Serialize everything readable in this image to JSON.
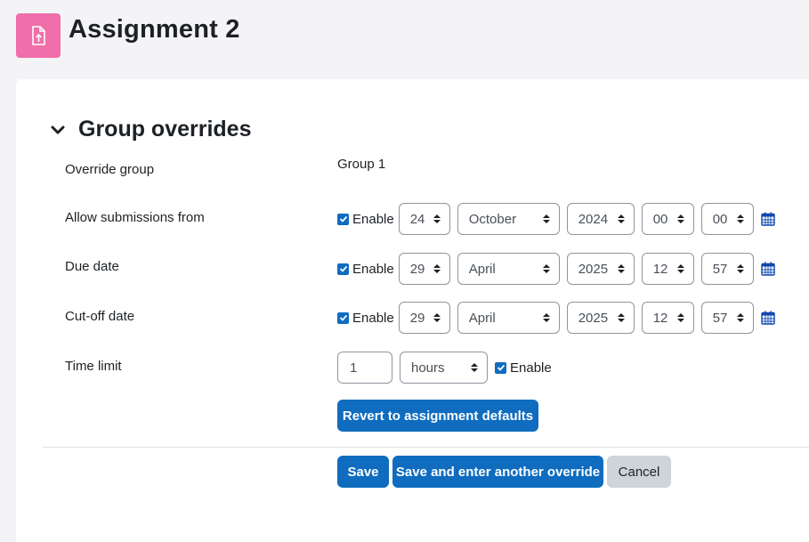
{
  "page": {
    "title": "Assignment 2",
    "icon": "assignment-upload-icon",
    "icon_color": "#f06eaa"
  },
  "section": {
    "title": "Group overrides"
  },
  "fields": {
    "override_group": {
      "label": "Override group",
      "value": "Group 1"
    },
    "allow_from": {
      "label": "Allow submissions from",
      "enable_label": "Enable",
      "day": "24",
      "month": "October",
      "year": "2024",
      "hour": "00",
      "minute": "00"
    },
    "due_date": {
      "label": "Due date",
      "enable_label": "Enable",
      "day": "29",
      "month": "April",
      "year": "2025",
      "hour": "12",
      "minute": "57"
    },
    "cutoff_date": {
      "label": "Cut-off date",
      "enable_label": "Enable",
      "day": "29",
      "month": "April",
      "year": "2025",
      "hour": "12",
      "minute": "57"
    },
    "time_limit": {
      "label": "Time limit",
      "value": "1",
      "unit": "hours",
      "enable_label": "Enable"
    }
  },
  "buttons": {
    "revert": "Revert to assignment defaults",
    "save": "Save",
    "save_another": "Save and enter another override",
    "cancel": "Cancel"
  },
  "colors": {
    "primary": "#0f6cbf",
    "secondary": "#ced4da"
  }
}
